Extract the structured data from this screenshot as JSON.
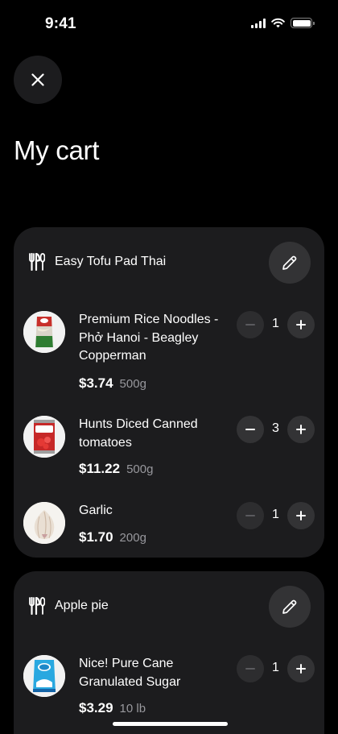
{
  "status": {
    "time": "9:41"
  },
  "page": {
    "title": "My cart"
  },
  "icons": {
    "close": "close-icon",
    "utensils": "utensils-icon",
    "edit": "pencil-icon",
    "minus": "minus-icon",
    "plus": "plus-icon"
  },
  "colors": {
    "background": "#000000",
    "card": "#1c1c1e",
    "button": "#333335",
    "muted_text": "#98989d"
  },
  "recipes": [
    {
      "title": "Easy Tofu Pad Thai",
      "items": [
        {
          "name": "Premium Rice Noodles - Phở Hanoi - Beagley Copperman",
          "price": "$3.74",
          "weight": "500g",
          "quantity": "1",
          "minus_enabled": false
        },
        {
          "name": "Hunts Diced Canned tomatoes",
          "price": "$11.22",
          "weight": "500g",
          "quantity": "3",
          "minus_enabled": true
        },
        {
          "name": "Garlic",
          "price": "$1.70",
          "weight": "200g",
          "quantity": "1",
          "minus_enabled": false
        }
      ]
    },
    {
      "title": "Apple pie",
      "items": [
        {
          "name": "Nice! Pure Cane Granulated Sugar",
          "price": "$3.29",
          "weight": "10 lb",
          "quantity": "1",
          "minus_enabled": false
        }
      ]
    }
  ]
}
